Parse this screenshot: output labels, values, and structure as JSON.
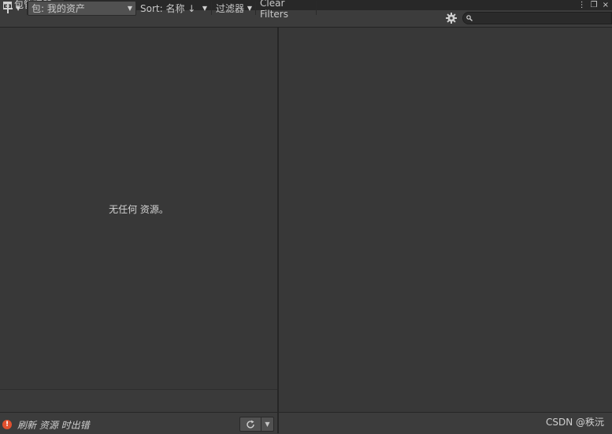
{
  "window": {
    "tab_title": "包管理器",
    "tab_icon": "package-icon"
  },
  "toolbar": {
    "add_icon": "plus-icon",
    "packages_dropdown": "包: 我的资产",
    "sort_dropdown": "Sort: 名称 ↓",
    "filter_dropdown": "过滤器",
    "clear_filters": "Clear Filters",
    "settings_icon": "gear-icon",
    "search_icon": "search-icon",
    "search_value": ""
  },
  "list": {
    "empty_message": "无任何 资源。"
  },
  "status": {
    "error_icon": "error-icon",
    "message": "刷新 资源 时出错",
    "refresh_icon": "refresh-icon"
  },
  "watermark": "CSDN @秩沅",
  "colors": {
    "background": "#383838",
    "toolbar": "#3c3c3c",
    "error": "#e0502e"
  }
}
